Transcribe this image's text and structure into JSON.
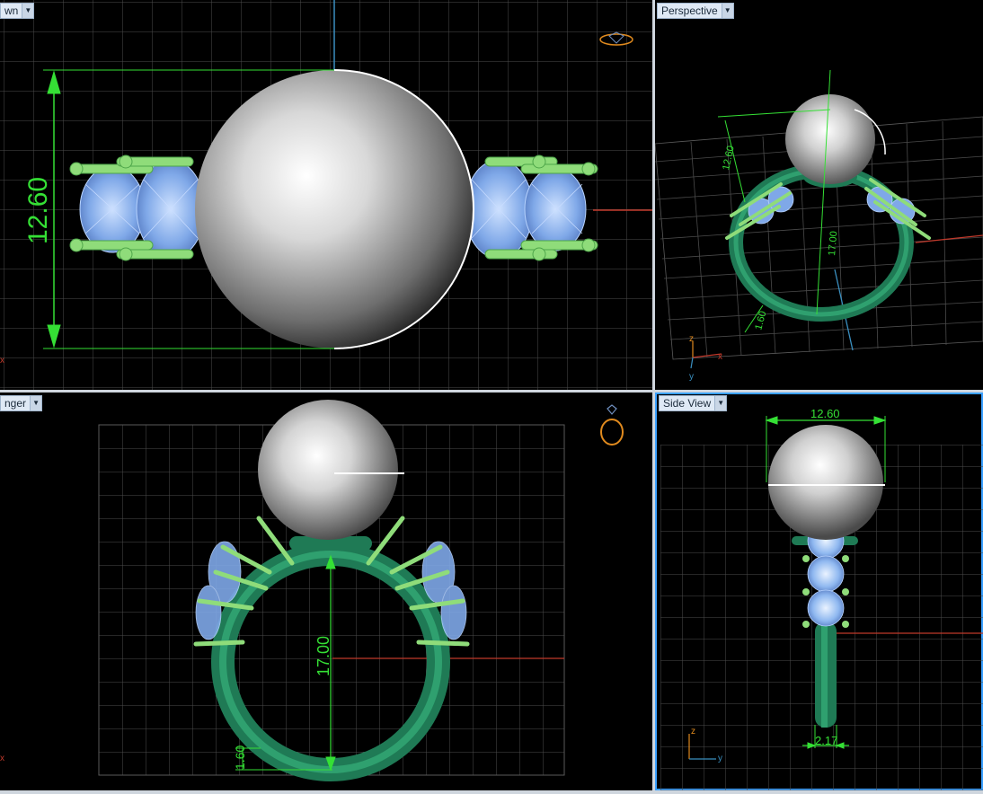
{
  "viewports": {
    "top_left": {
      "label": "wn",
      "dimension": "12.60"
    },
    "top_right": {
      "label": "Perspective",
      "dim_gem": "12.60",
      "dim_ring": "17.00",
      "dim_band": "1.60",
      "axis_z": "z",
      "axis_x": "x",
      "axis_y": "y"
    },
    "bottom_left": {
      "label": "nger",
      "dim_inner": "17.00",
      "dim_band": "1.60"
    },
    "bottom_right": {
      "label": "Side View",
      "dim_top": "12.60",
      "dim_bottom": "2.17",
      "axis_z": "z",
      "axis_y": "y"
    }
  },
  "axis_mark_x": "x",
  "colors": {
    "viewport_bg": "#000000",
    "grid": "#5a5a5a",
    "metal_green": "#2e8b57",
    "prong_green": "#8fdc7a",
    "gem_blue": "#8fb8f0",
    "pearl": "#e8e8e8",
    "dimension": "#35e035",
    "axis_red": "#c0392b",
    "axis_blue": "#3a8fc0",
    "label_bg": "#dfe9f5"
  }
}
